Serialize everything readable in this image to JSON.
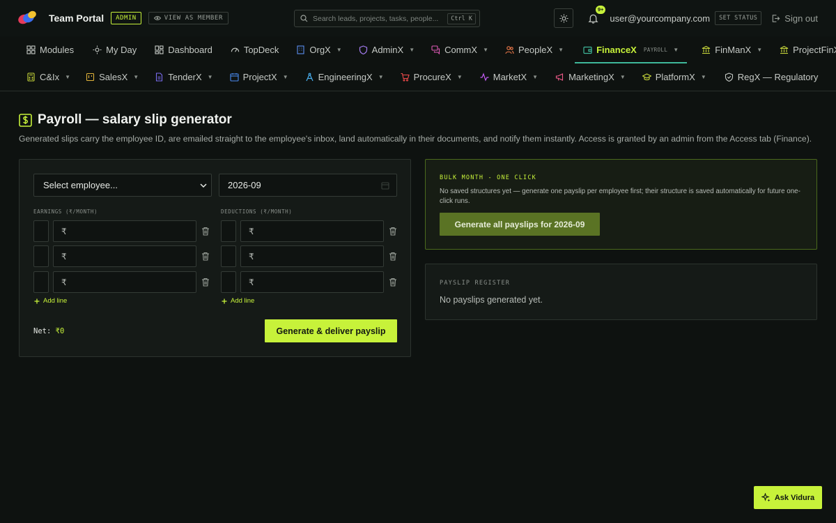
{
  "app": {
    "name": "Team Portal",
    "role_badge": "ADMIN",
    "view_as_label": "VIEW AS MEMBER"
  },
  "search": {
    "placeholder": "Search leads, projects, tasks, people...",
    "shortcut": "Ctrl K"
  },
  "header": {
    "notifications_badge": "9+",
    "user_email": "user@yourcompany.com",
    "set_status_label": "SET STATUS",
    "sign_out_label": "Sign out"
  },
  "nav": {
    "row1": [
      {
        "label": "Modules",
        "icon": "grid-icon",
        "chevron": false
      },
      {
        "label": "My Day",
        "icon": "sun-icon",
        "chevron": false
      },
      {
        "label": "Dashboard",
        "icon": "dashboard-icon",
        "chevron": false
      },
      {
        "label": "TopDeck",
        "icon": "gauge-icon",
        "chevron": false
      },
      {
        "label": "OrgX",
        "icon": "building-icon",
        "chevron": true
      },
      {
        "label": "AdminX",
        "icon": "shield-icon",
        "chevron": true
      },
      {
        "label": "CommX",
        "icon": "chat-icon",
        "chevron": true
      },
      {
        "label": "PeopleX",
        "icon": "people-icon",
        "chevron": true
      },
      {
        "label": "FinanceX",
        "sub": "PAYROLL",
        "icon": "wallet-icon",
        "chevron": true,
        "active": true
      },
      {
        "label": "FinManX",
        "icon": "bank-icon",
        "chevron": true
      },
      {
        "label": "ProjectFinX",
        "icon": "bank-icon",
        "chevron": true
      }
    ],
    "row2": [
      {
        "label": "C&Ix",
        "icon": "calculator-icon",
        "chevron": true
      },
      {
        "label": "SalesX",
        "icon": "sales-icon",
        "chevron": true
      },
      {
        "label": "TenderX",
        "icon": "document-icon",
        "chevron": true
      },
      {
        "label": "ProjectX",
        "icon": "calendar-icon",
        "chevron": true
      },
      {
        "label": "EngineeringX",
        "icon": "compass-icon",
        "chevron": true
      },
      {
        "label": "ProcureX",
        "icon": "cart-icon",
        "chevron": true
      },
      {
        "label": "MarketX",
        "icon": "pulse-icon",
        "chevron": true
      },
      {
        "label": "MarketingX",
        "icon": "megaphone-icon",
        "chevron": true
      },
      {
        "label": "PlatformX",
        "icon": "graduation-icon",
        "chevron": true
      },
      {
        "label": "RegX — Regulatory",
        "icon": "shield-check-icon",
        "chevron": false
      }
    ]
  },
  "page": {
    "title": "Payroll — salary slip generator",
    "description": "Generated slips carry the employee ID, are emailed straight to the employee's inbox, land automatically in their documents, and notify them instantly. Access is granted by an admin from the Access tab (Finance)."
  },
  "form": {
    "employee_select": "Select employee...",
    "month": "2026-09",
    "earnings_label": "EARNINGS (₹/MONTH)",
    "deductions_label": "DEDUCTIONS (₹/MONTH)",
    "currency_symbol": "₹",
    "add_line_label": "Add line",
    "net_label": "Net:",
    "net_value": "₹0",
    "generate_label": "Generate & deliver payslip"
  },
  "bulk": {
    "title": "BULK MONTH - ONE CLICK",
    "text": "No saved structures yet — generate one payslip per employee first; their structure is saved automatically for future one-click runs.",
    "button_label": "Generate all payslips for 2026-09"
  },
  "register": {
    "title": "PAYSLIP REGISTER",
    "empty_text": "No payslips generated yet."
  },
  "assistant": {
    "label": "Ask Vidura"
  },
  "colors": {
    "accent": "#c7f23a",
    "active_underline": "#3fb89a",
    "background": "#0e1210"
  }
}
